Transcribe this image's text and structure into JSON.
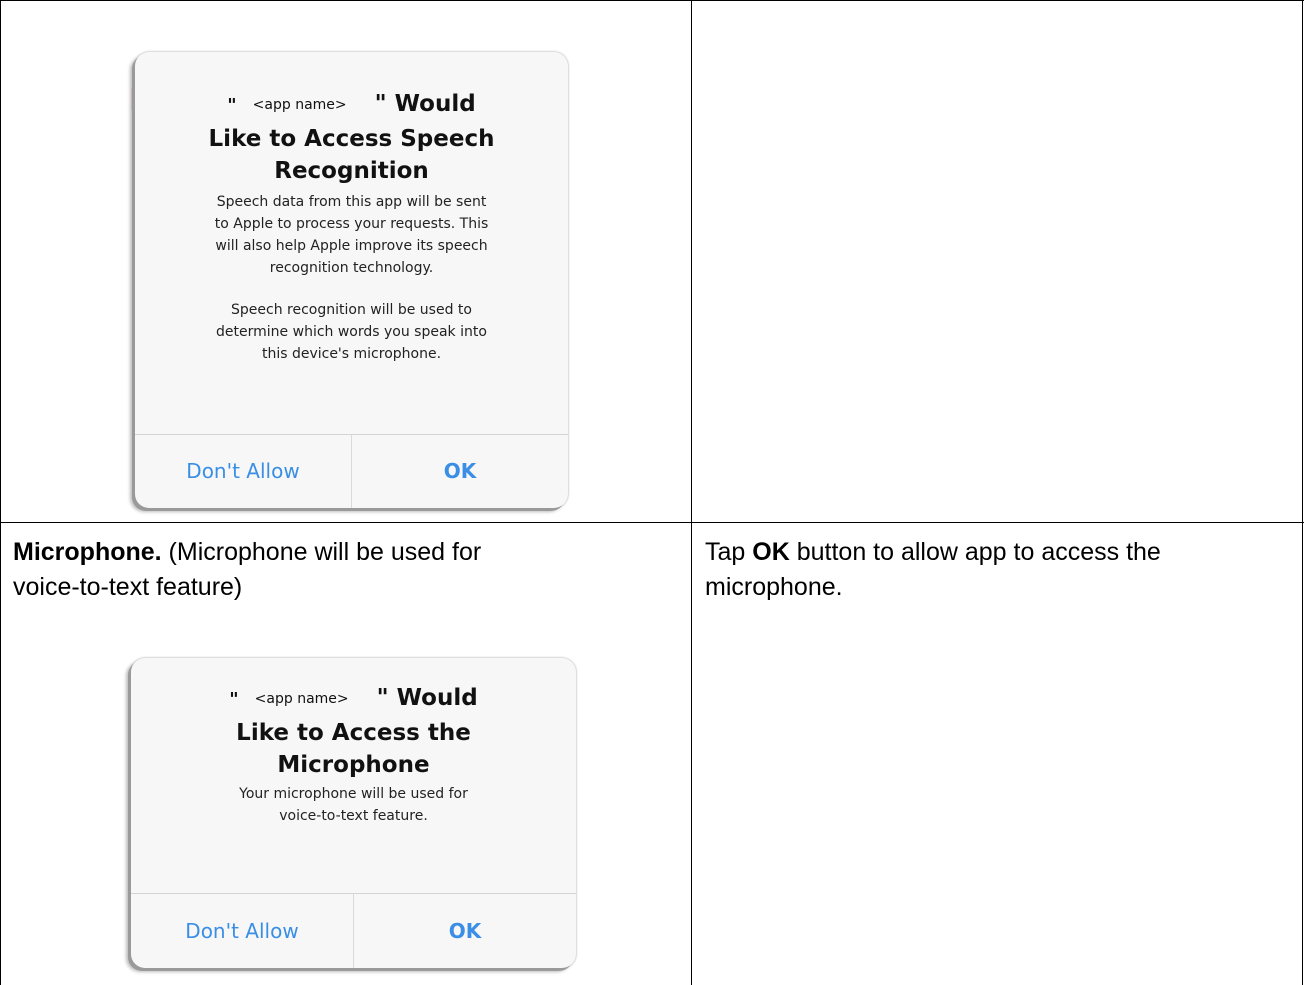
{
  "row1": {
    "left_alert": {
      "title_quote_open": "\"",
      "title_app_name": "<app name>",
      "title_quote_close_would": "\" Would",
      "title_line2": "Like to Access Speech",
      "title_line3": "Recognition",
      "message_p1_lines": [
        "Speech data from this app will be sent",
        "to Apple to process your requests. This",
        "will also help Apple improve its speech",
        "recognition technology."
      ],
      "message_p2_lines": [
        "Speech recognition will be used to",
        "determine which words you speak into",
        "this device's microphone."
      ],
      "button_dont_allow": "Don't Allow",
      "button_ok": "OK"
    },
    "right_text": ""
  },
  "row2": {
    "left_text_bold": "Microphone.",
    "left_text_rest_line1": " (Microphone will be used for",
    "left_text_line2": "voice-to-text feature)",
    "left_alert": {
      "title_quote_open": "\"",
      "title_app_name": "<app name>",
      "title_quote_close_would": "\" Would",
      "title_line2": "Like to Access the",
      "title_line3": "Microphone",
      "message_lines": [
        "Your microphone will be used for",
        "voice-to-text feature."
      ],
      "button_dont_allow": "Don't Allow",
      "button_ok": "OK"
    },
    "right_text_pre": "Tap ",
    "right_text_bold": "OK",
    "right_text_post": " button to allow app to access the",
    "right_text_line2": "microphone."
  },
  "colors": {
    "ios_blue": "#3a8ee6",
    "alert_bg": "#f7f7f7",
    "grid": "#000000"
  }
}
